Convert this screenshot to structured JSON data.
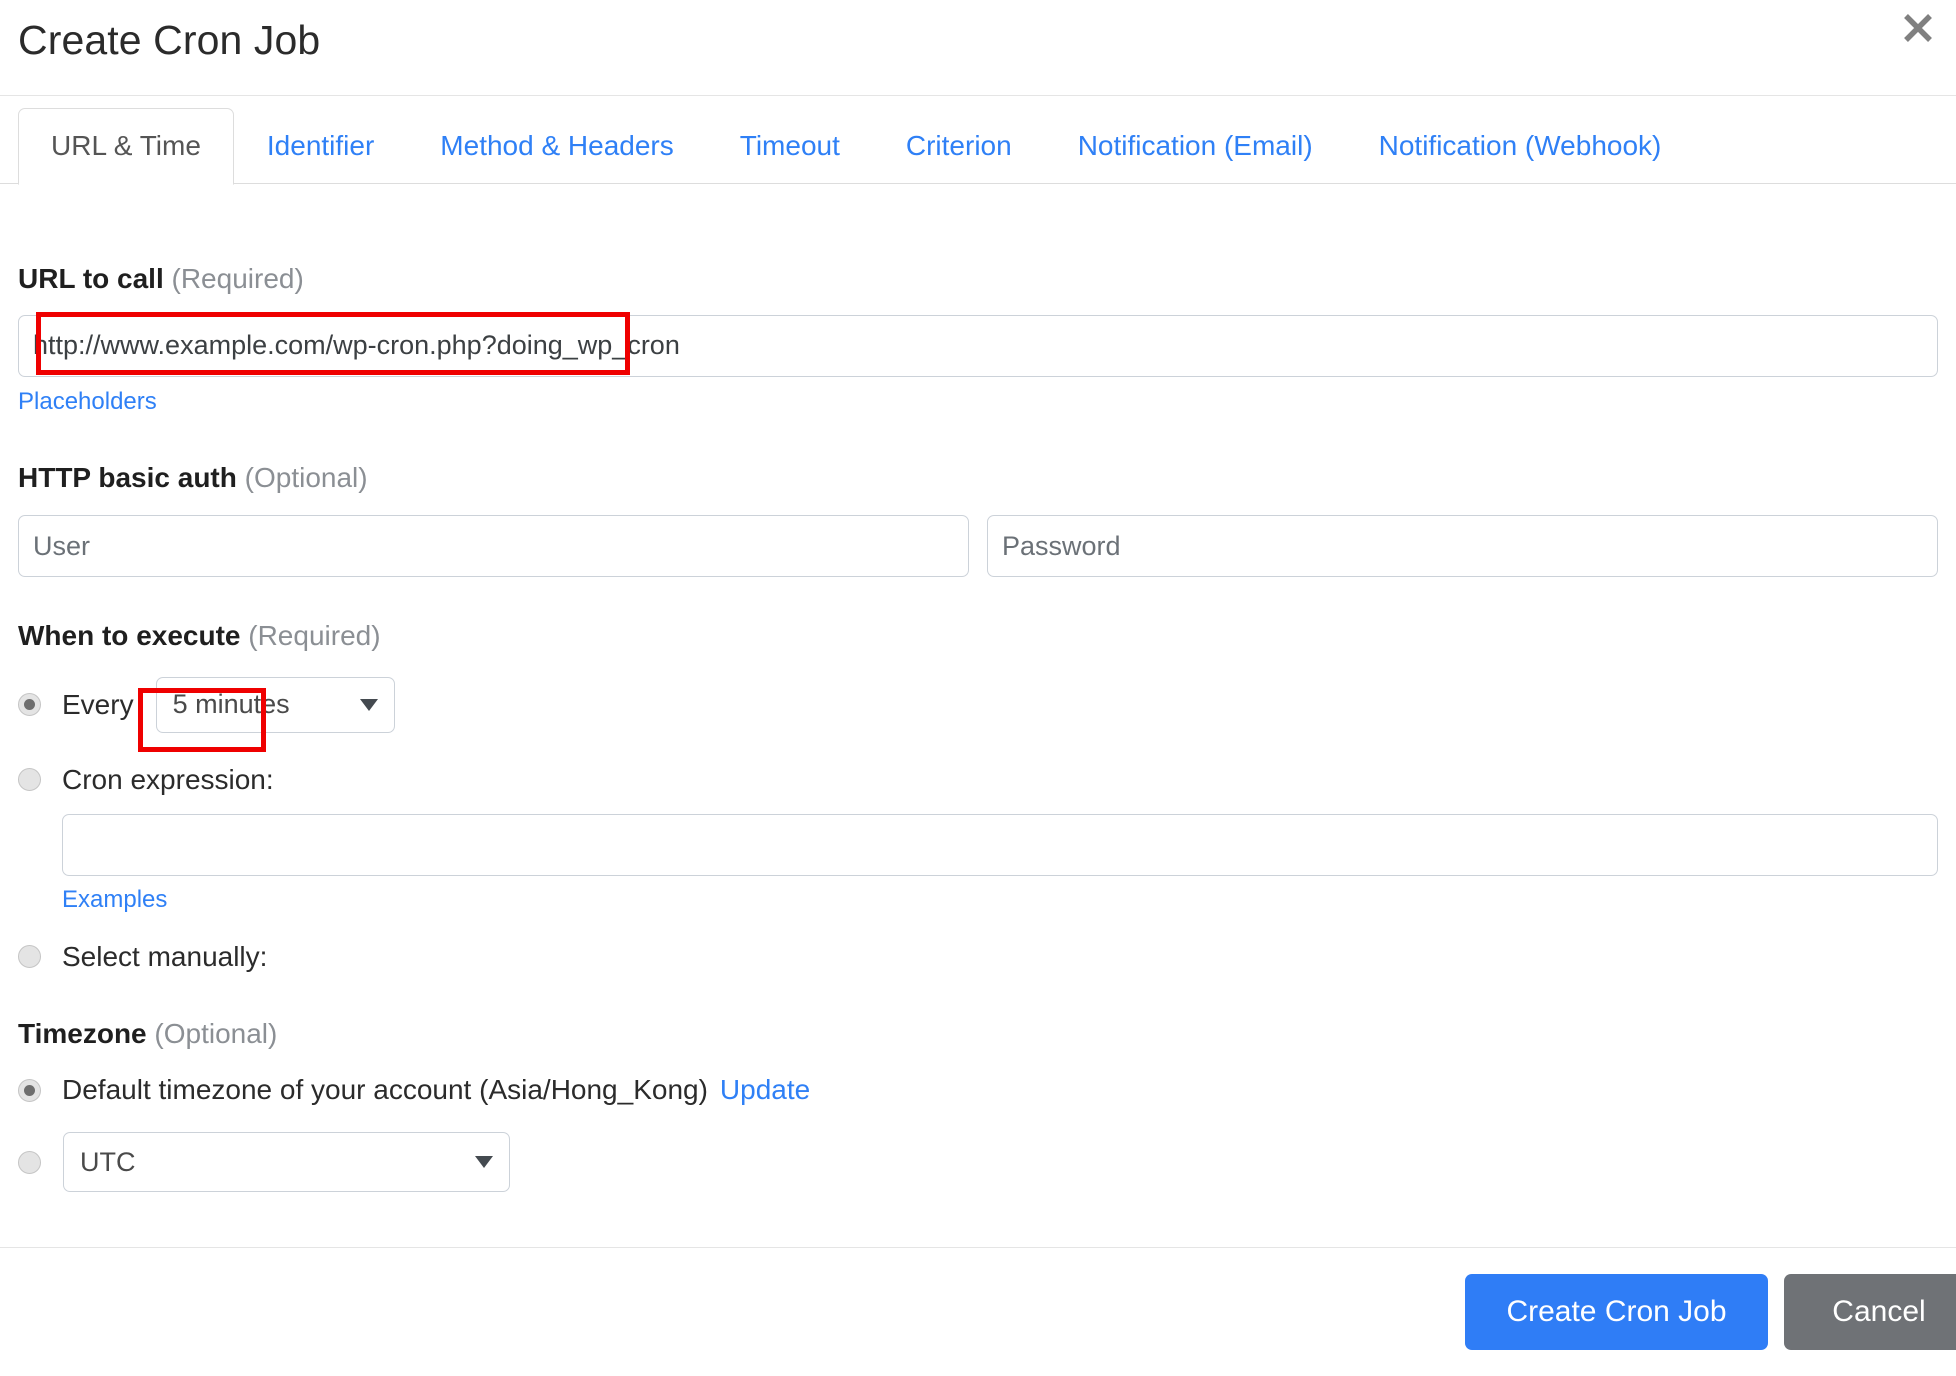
{
  "modal": {
    "title": "Create Cron Job",
    "close_icon": "close-icon"
  },
  "tabs": [
    {
      "label": "URL & Time",
      "active": true
    },
    {
      "label": "Identifier",
      "active": false
    },
    {
      "label": "Method & Headers",
      "active": false
    },
    {
      "label": "Timeout",
      "active": false
    },
    {
      "label": "Criterion",
      "active": false
    },
    {
      "label": "Notification (Email)",
      "active": false
    },
    {
      "label": "Notification (Webhook)",
      "active": false
    }
  ],
  "url_section": {
    "label": "URL to call",
    "label_suffix": "(Required)",
    "input_value": "http://www.example.com/wp-cron.php?doing_wp_cron",
    "placeholders_link": "Placeholders"
  },
  "auth_section": {
    "label": "HTTP basic auth",
    "label_suffix": "(Optional)",
    "user_placeholder": "User",
    "user_value": "",
    "password_placeholder": "Password",
    "password_value": ""
  },
  "execute_section": {
    "label": "When to execute",
    "label_suffix": "(Required)",
    "every_label": "Every",
    "every_selected": "5 minutes",
    "every_checked": true,
    "cron_expression_label": "Cron expression:",
    "cron_expression_checked": false,
    "cron_expression_value": "",
    "examples_link": "Examples",
    "select_manually_label": "Select manually:",
    "select_manually_checked": false
  },
  "timezone_section": {
    "label": "Timezone",
    "label_suffix": "(Optional)",
    "default_label": "Default timezone of your account (Asia/Hong_Kong)",
    "default_checked": true,
    "update_link": "Update",
    "custom_checked": false,
    "custom_selected": "UTC"
  },
  "footer": {
    "submit_label": "Create Cron Job",
    "cancel_label": "Cancel"
  },
  "colors": {
    "link_blue": "#2f80f6",
    "primary_button": "#2f7df6",
    "cancel_button": "#6f7276",
    "annotation_red": "#ef0000"
  }
}
